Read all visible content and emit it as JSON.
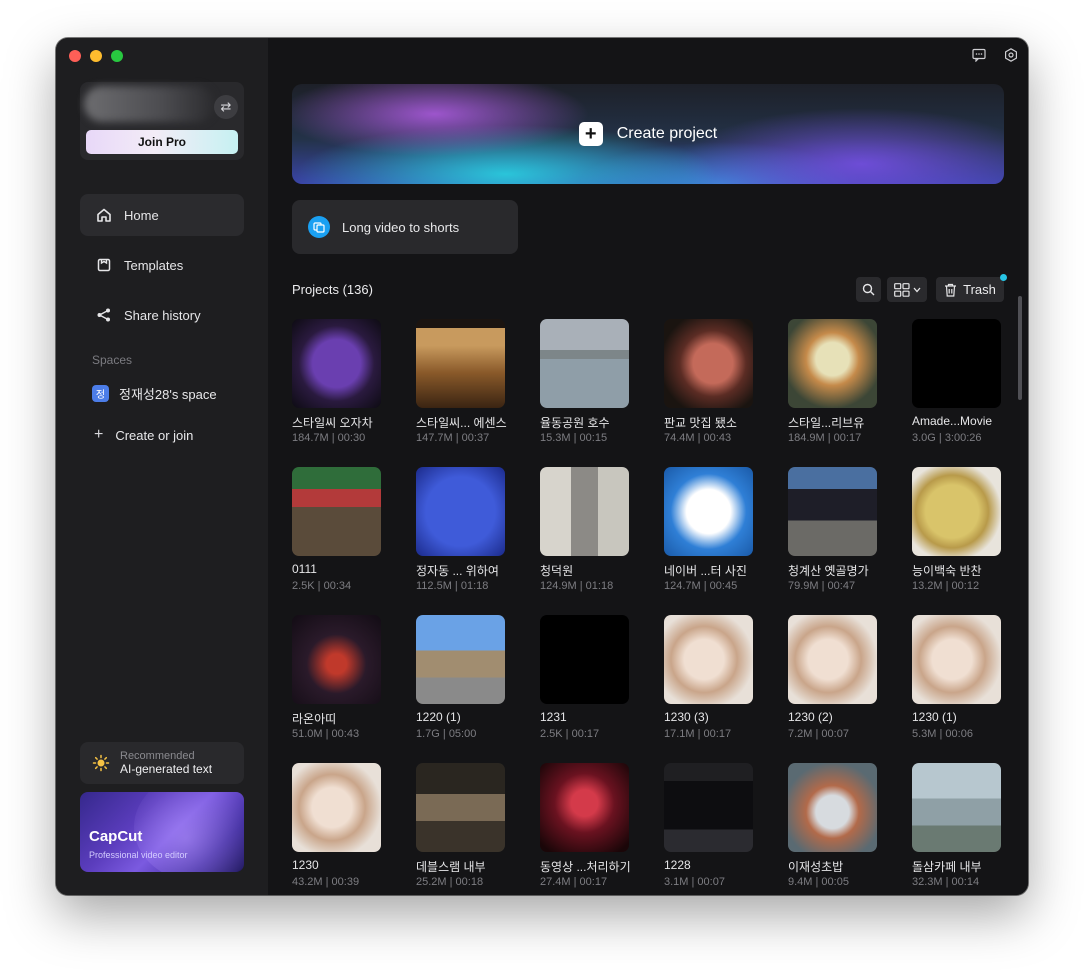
{
  "sidebar": {
    "join_pro": "Join Pro",
    "nav": [
      {
        "label": "Home",
        "icon": "home-icon",
        "active": true
      },
      {
        "label": "Templates",
        "icon": "templates-icon",
        "active": false
      },
      {
        "label": "Share history",
        "icon": "share-icon",
        "active": false
      }
    ],
    "spaces_label": "Spaces",
    "space": {
      "badge": "정",
      "name": "정재성28's space"
    },
    "create_or_join": "Create or join",
    "recommend": {
      "small": "Recommended",
      "main": "AI-generated text"
    },
    "promo": {
      "title": "CapCut",
      "subtitle": "Professional video editor"
    }
  },
  "main": {
    "create_project": "Create project",
    "long_video": "Long video to shorts",
    "projects_label": "Projects",
    "projects_count": "(136)",
    "trash_label": "Trash",
    "projects": [
      {
        "name": "스타일씨 오자차",
        "meta": "184.7M | 00:30",
        "thumb": "purple-box"
      },
      {
        "name": "스타일씨... 에센스",
        "meta": "147.7M | 00:37",
        "thumb": "bottle"
      },
      {
        "name": "율동공원 호수",
        "meta": "15.3M | 00:15",
        "thumb": "lake"
      },
      {
        "name": "판교 맛집 됐소",
        "meta": "74.4M | 00:43",
        "thumb": "grill"
      },
      {
        "name": "스타일...리브유",
        "meta": "184.9M | 00:17",
        "thumb": "shrimp"
      },
      {
        "name": "Amade...Movie",
        "meta": "3.0G | 3:00:26",
        "thumb": "black"
      },
      {
        "name": "0111",
        "meta": "2.5K | 00:34",
        "thumb": "shop"
      },
      {
        "name": "정자동 ... 위하여",
        "meta": "112.5M | 01:18",
        "thumb": "beer-sign"
      },
      {
        "name": "청덕원",
        "meta": "124.9M | 01:18",
        "thumb": "sign-post"
      },
      {
        "name": "네이버 ...터 사진",
        "meta": "124.7M | 00:45",
        "thumb": "blue-card"
      },
      {
        "name": "청계산 옛골명가",
        "meta": "79.9M | 00:47",
        "thumb": "building"
      },
      {
        "name": "능이백숙 반찬",
        "meta": "13.2M | 00:12",
        "thumb": "pancake"
      },
      {
        "name": "라온아띠",
        "meta": "51.0M | 00:43",
        "thumb": "neon"
      },
      {
        "name": "1220 (1)",
        "meta": "1.7G | 05:00",
        "thumb": "trail"
      },
      {
        "name": "1231",
        "meta": "2.5K | 00:17",
        "thumb": "black"
      },
      {
        "name": "1230 (3)",
        "meta": "17.1M | 00:17",
        "thumb": "spa"
      },
      {
        "name": "1230 (2)",
        "meta": "7.2M | 00:07",
        "thumb": "spa"
      },
      {
        "name": "1230 (1)",
        "meta": "5.3M | 00:06",
        "thumb": "spa"
      },
      {
        "name": "1230",
        "meta": "43.2M | 00:39",
        "thumb": "spa"
      },
      {
        "name": "데블스램 내부",
        "meta": "25.2M | 00:18",
        "thumb": "bar"
      },
      {
        "name": "동영상 ...처리하기",
        "meta": "27.4M | 00:17",
        "thumb": "red-dark"
      },
      {
        "name": "1228",
        "meta": "3.1M | 00:07",
        "thumb": "editor"
      },
      {
        "name": "이재성초밥",
        "meta": "9.4M | 00:05",
        "thumb": "sushi"
      },
      {
        "name": "돌삼카페 내부",
        "meta": "32.3M | 00:14",
        "thumb": "cafe"
      }
    ]
  },
  "colors": {
    "accent": "#1aa0f2",
    "window_bg": "#141416",
    "sidebar_bg": "#1e1e20"
  }
}
